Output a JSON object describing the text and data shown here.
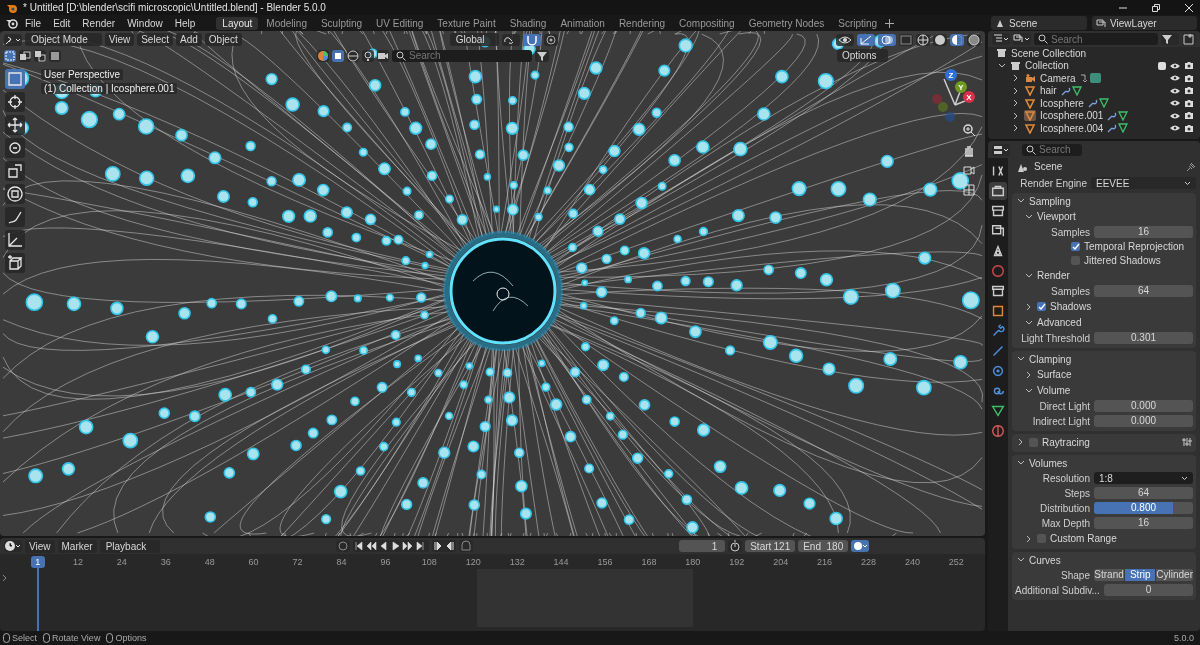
{
  "window": {
    "title": "* Untitled [D:\\blender\\scifi microscopic\\Untitled.blend] - Blender 5.0.0"
  },
  "menu_bar": [
    "File",
    "Edit",
    "Render",
    "Window",
    "Help"
  ],
  "workspace_tabs": [
    {
      "label": "Layout",
      "selected": true
    },
    {
      "label": "Modeling",
      "selected": false
    },
    {
      "label": "Sculpting",
      "selected": false
    },
    {
      "label": "UV Editing",
      "selected": false
    },
    {
      "label": "Texture Paint",
      "selected": false
    },
    {
      "label": "Shading",
      "selected": false
    },
    {
      "label": "Animation",
      "selected": false
    },
    {
      "label": "Rendering",
      "selected": false
    },
    {
      "label": "Compositing",
      "selected": false
    },
    {
      "label": "Geometry Nodes",
      "selected": false
    },
    {
      "label": "Scripting",
      "selected": false
    }
  ],
  "scene_selector": "Scene",
  "view_layer_selector": "ViewLayer",
  "viewport": {
    "mode": "Object Mode",
    "menus": [
      "View",
      "Select",
      "Add",
      "Object"
    ],
    "orientation": "Global",
    "search": {
      "placeholder": "Search"
    },
    "options": "Options",
    "perspective": "User Perspective",
    "active_object": "(1) Collection | Icosphere.001",
    "tools": [
      {
        "kind": "select",
        "selected": true
      },
      {
        "kind": "cursor",
        "selected": false
      },
      {
        "kind": "move",
        "selected": false
      },
      {
        "kind": "rotate",
        "selected": false
      },
      {
        "kind": "scale",
        "selected": false
      },
      {
        "kind": "transform",
        "selected": false
      },
      {
        "kind": "annotate",
        "selected": false
      },
      {
        "kind": "measure",
        "selected": false
      },
      {
        "kind": "add-cube",
        "selected": false
      }
    ],
    "gizmo_axes": [
      {
        "label": "Z",
        "color": "#2f6fd8"
      },
      {
        "label": "Y",
        "color": "#6f9a1f"
      },
      {
        "label": "X",
        "color": "#d6334a"
      }
    ]
  },
  "outliner": {
    "search": {
      "placeholder": "Search"
    },
    "tree": [
      {
        "label": "Scene Collection",
        "children": [
          {
            "label": "Collection",
            "expanded": true,
            "checked": true,
            "children": [
              {
                "label": "Camera",
                "kind": "camera",
                "expanded": false,
                "selected": false
              },
              {
                "label": "hair",
                "kind": "mesh",
                "expanded": false,
                "selected": false
              },
              {
                "label": "Icosphere",
                "kind": "mesh",
                "expanded": false,
                "selected": false
              },
              {
                "label": "Icosphere.001",
                "kind": "mesh",
                "expanded": false,
                "selected": true
              },
              {
                "label": "Icosphere.004",
                "kind": "mesh",
                "expanded": false,
                "selected": false
              }
            ]
          }
        ]
      }
    ]
  },
  "properties": {
    "search": {
      "placeholder": "Search"
    },
    "context": "Scene",
    "tabs": [
      {
        "kind": "tool",
        "selected": false
      },
      {
        "kind": "render",
        "selected": true
      },
      {
        "kind": "output",
        "selected": false
      },
      {
        "kind": "view-layer",
        "selected": false
      },
      {
        "kind": "scene",
        "selected": false
      },
      {
        "kind": "world",
        "selected": false
      },
      {
        "kind": "collection",
        "selected": false
      },
      {
        "kind": "object",
        "selected": false
      },
      {
        "kind": "modifier",
        "selected": false
      },
      {
        "kind": "particles",
        "selected": false
      },
      {
        "kind": "physics",
        "selected": false
      },
      {
        "kind": "constraint",
        "selected": false
      },
      {
        "kind": "data",
        "selected": false
      },
      {
        "kind": "material",
        "selected": false
      }
    ],
    "render_engine": {
      "label": "Render Engine",
      "value": "EEVEE"
    },
    "panels": [
      {
        "title": "Sampling",
        "expanded": true,
        "items": [
          {
            "kind": "subpanel",
            "title": "Viewport",
            "expanded": true,
            "items": [
              {
                "kind": "number",
                "label": "Samples",
                "value": "16"
              },
              {
                "kind": "checkbox",
                "label": "Temporal Reprojection",
                "checked": true
              },
              {
                "kind": "checkbox",
                "label": "Jittered Shadows",
                "checked": false
              }
            ]
          },
          {
            "kind": "subpanel",
            "title": "Render",
            "expanded": true,
            "items": [
              {
                "kind": "number",
                "label": "Samples",
                "value": "64"
              }
            ]
          },
          {
            "kind": "subpanel",
            "title": "Shadows",
            "expanded": false,
            "checked": true
          },
          {
            "kind": "subpanel",
            "title": "Advanced",
            "expanded": true,
            "items": [
              {
                "kind": "number",
                "label": "Light Threshold",
                "value": "0.301"
              }
            ]
          }
        ]
      },
      {
        "title": "Clamping",
        "expanded": true,
        "items": [
          {
            "kind": "subpanel",
            "title": "Surface",
            "expanded": false
          },
          {
            "kind": "subpanel",
            "title": "Volume",
            "expanded": true,
            "items": [
              {
                "kind": "number",
                "label": "Direct Light",
                "value": "0.000"
              },
              {
                "kind": "number",
                "label": "Indirect Light",
                "value": "0.000"
              }
            ]
          }
        ]
      },
      {
        "title": "Raytracing",
        "expanded": false,
        "checked": false
      },
      {
        "title": "Volumes",
        "expanded": true,
        "items": [
          {
            "kind": "dropdown",
            "label": "Resolution",
            "value": "1:8"
          },
          {
            "kind": "number",
            "label": "Steps",
            "value": "64"
          },
          {
            "kind": "slider",
            "label": "Distribution",
            "value": "0.800",
            "level": 0.8
          },
          {
            "kind": "number",
            "label": "Max Depth",
            "value": "16"
          },
          {
            "kind": "subpanel",
            "title": "Custom Range",
            "expanded": false,
            "checked": false
          }
        ]
      },
      {
        "title": "Curves",
        "expanded": true,
        "items": [
          {
            "kind": "enum",
            "label": "Shape",
            "options": [
              {
                "label": "Strand",
                "selected": false
              },
              {
                "label": "Strip",
                "selected": true
              },
              {
                "label": "Cylinder",
                "selected": false
              }
            ]
          },
          {
            "kind": "number",
            "label": "Additional Subdiv...",
            "value": "0"
          }
        ]
      }
    ]
  },
  "timeline": {
    "menus": [
      "View",
      "Marker"
    ],
    "playback": "Playback",
    "current_frame": "1",
    "playhead": "1",
    "start_label": "Start",
    "start": "121",
    "end_label": "End",
    "end": "180",
    "ticks": [
      "12",
      "24",
      "36",
      "48",
      "60",
      "72",
      "84",
      "96",
      "108",
      "120",
      "132",
      "144",
      "156",
      "168",
      "180",
      "192",
      "204",
      "216",
      "228",
      "240",
      "252"
    ]
  },
  "status_bar": {
    "hints": [
      "Select",
      "Rotate View",
      "Options"
    ],
    "version": "5.0.0"
  }
}
